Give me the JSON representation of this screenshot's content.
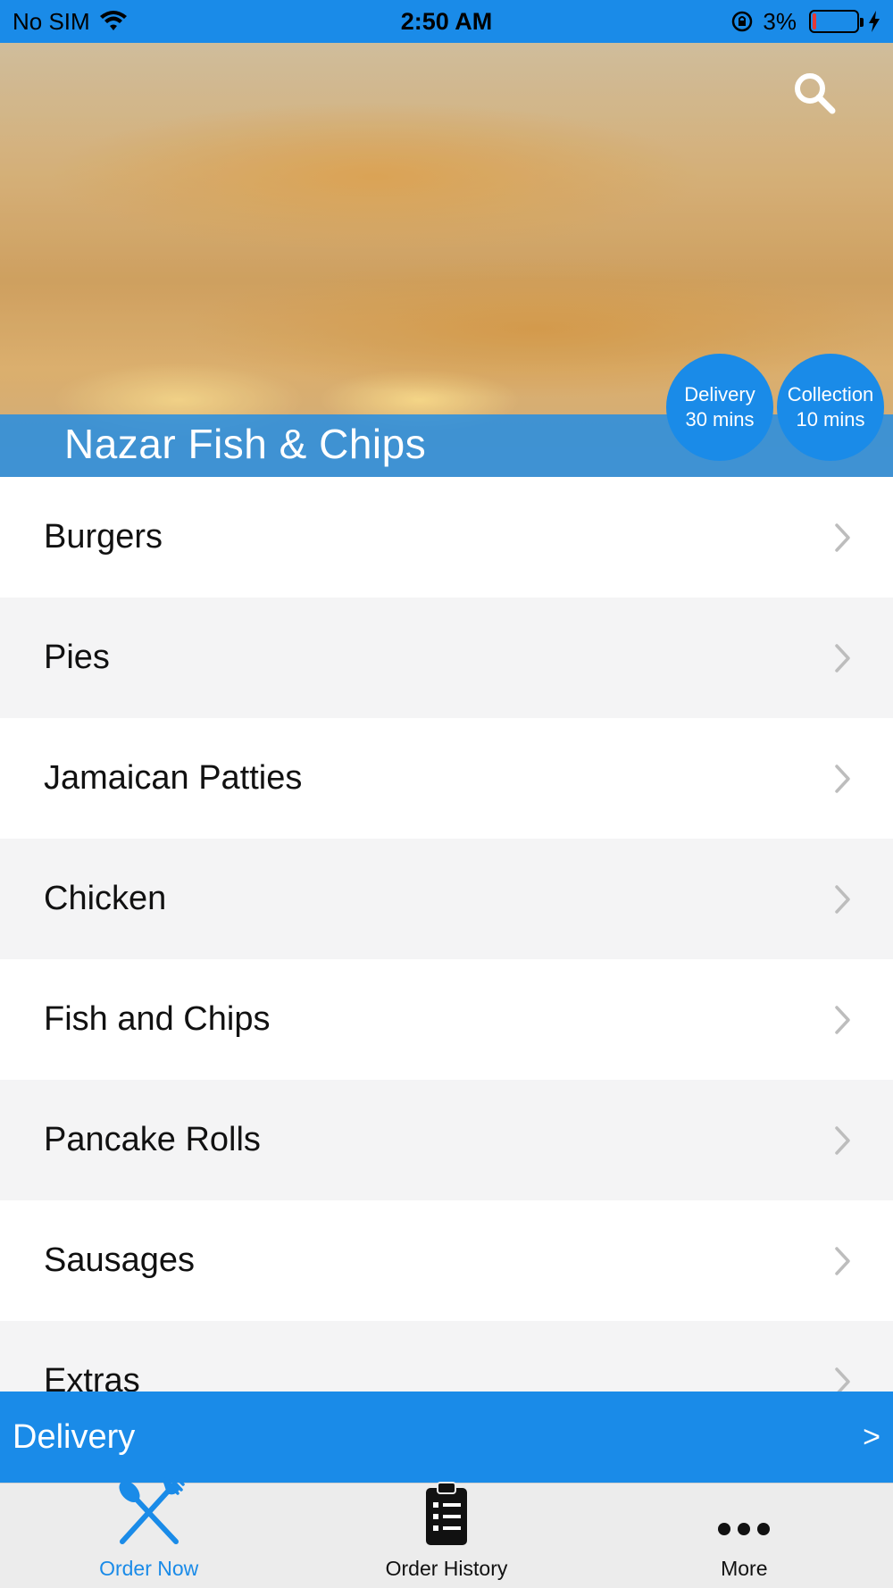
{
  "status_bar": {
    "carrier": "No SIM",
    "time": "2:50 AM",
    "battery_percent": "3%",
    "battery_level": 0.03
  },
  "hero": {
    "restaurant_name": "Nazar Fish & Chips",
    "delivery_badge": {
      "line1": "Delivery",
      "line2": "30 mins"
    },
    "collection_badge": {
      "line1": "Collection",
      "line2": "10 mins"
    }
  },
  "categories": [
    {
      "label": "Burgers"
    },
    {
      "label": "Pies"
    },
    {
      "label": "Jamaican Patties"
    },
    {
      "label": "Chicken"
    },
    {
      "label": "Fish and Chips"
    },
    {
      "label": "Pancake Rolls"
    },
    {
      "label": "Sausages"
    },
    {
      "label": "Extras"
    }
  ],
  "delivery_bar": {
    "label": "Delivery",
    "arrow": ">"
  },
  "tabs": [
    {
      "label": "Order Now",
      "icon": "fork-knife-icon",
      "active": true
    },
    {
      "label": "Order History",
      "icon": "clipboard-list-icon",
      "active": false
    },
    {
      "label": "More",
      "icon": "more-dots-icon",
      "active": false
    }
  ],
  "colors": {
    "accent": "#1a8be8",
    "list_alt_row": "#f4f4f5",
    "tab_bar_bg": "#ececec",
    "battery_low": "#e53935"
  }
}
